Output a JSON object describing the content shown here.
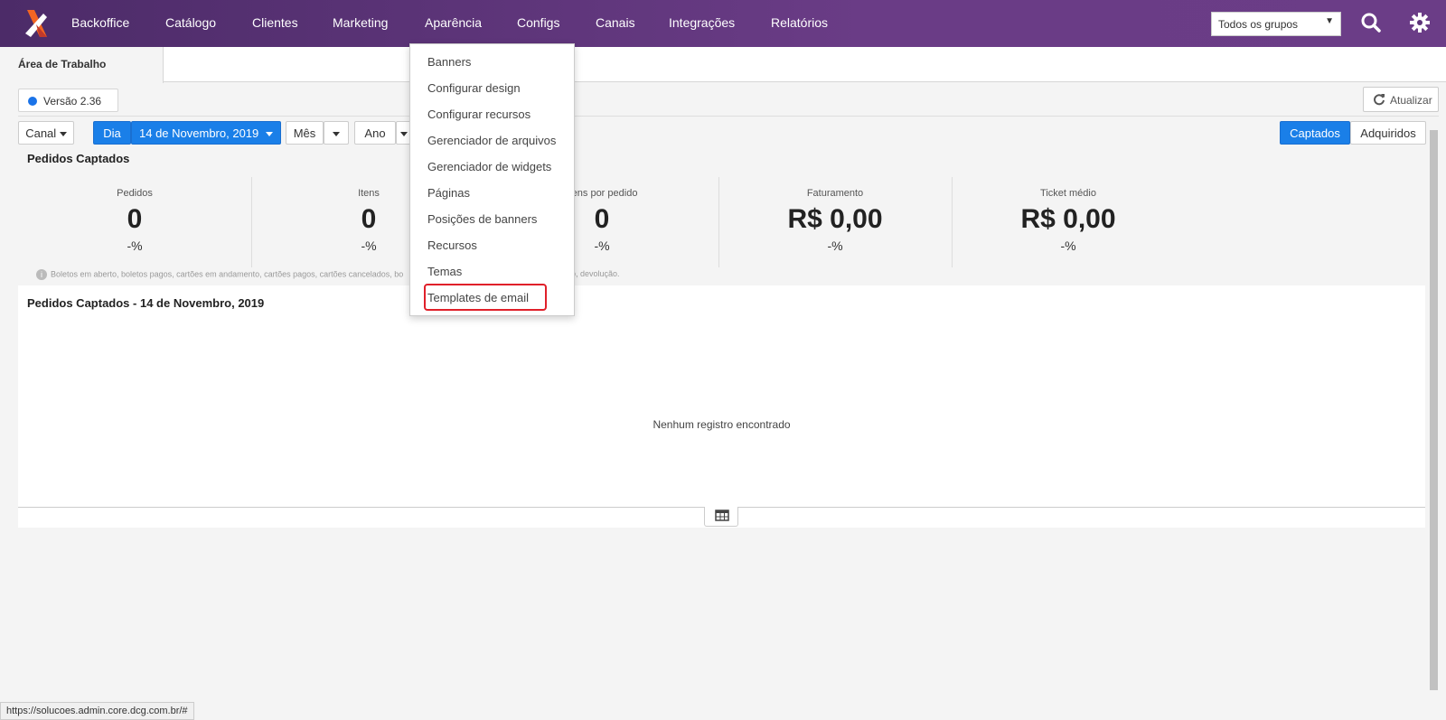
{
  "nav": {
    "items": [
      "Backoffice",
      "Catálogo",
      "Clientes",
      "Marketing",
      "Aparência",
      "Configs",
      "Canais",
      "Integrações",
      "Relatórios"
    ],
    "group_select": "Todos os grupos",
    "icons": [
      "search-icon",
      "gear-icon"
    ]
  },
  "tab": {
    "active": "Área de Trabalho"
  },
  "version": "Versão 2.36",
  "refresh_label": "Atualizar",
  "filters": {
    "canal": "Canal",
    "dia": "Dia",
    "date": "14 de Novembro, 2019",
    "mes": "Mês",
    "ano": "Ano",
    "captados": "Captados",
    "adquiridos": "Adquiridos"
  },
  "section_title": "Pedidos Captados",
  "kpis": [
    {
      "label": "Pedidos",
      "value": "0",
      "pct": "-%"
    },
    {
      "label": "Itens",
      "value": "0",
      "pct": "-%"
    },
    {
      "label": "Itens por pedido",
      "value": "0",
      "pct": "-%"
    },
    {
      "label": "Faturamento",
      "value": "R$ 0,00",
      "pct": "-%"
    },
    {
      "label": "Ticket médio",
      "value": "R$ 0,00",
      "pct": "-%"
    }
  ],
  "note": "Boletos em aberto, boletos pagos, cartões em andamento, cartões pagos, cartões cancelados, bo",
  "note_tail": "o, devolução.",
  "panel": {
    "title": "Pedidos Captados - 14 de Novembro, 2019",
    "empty": "Nenhum registro encontrado"
  },
  "dropdown": {
    "items": [
      "Banners",
      "Configurar design",
      "Configurar recursos",
      "Gerenciador de arquivos",
      "Gerenciador de widgets",
      "Páginas",
      "Posições de banners",
      "Recursos",
      "Temas",
      "Templates de email"
    ],
    "highlighted": "Templates de email"
  },
  "status_url": "https://solucoes.admin.core.dcg.com.br/#",
  "colors": {
    "nav_bg": "#5a3277",
    "accent_blue": "#1a7fe8",
    "highlight_red": "#e0202a",
    "logo_orange": "#f26522"
  }
}
